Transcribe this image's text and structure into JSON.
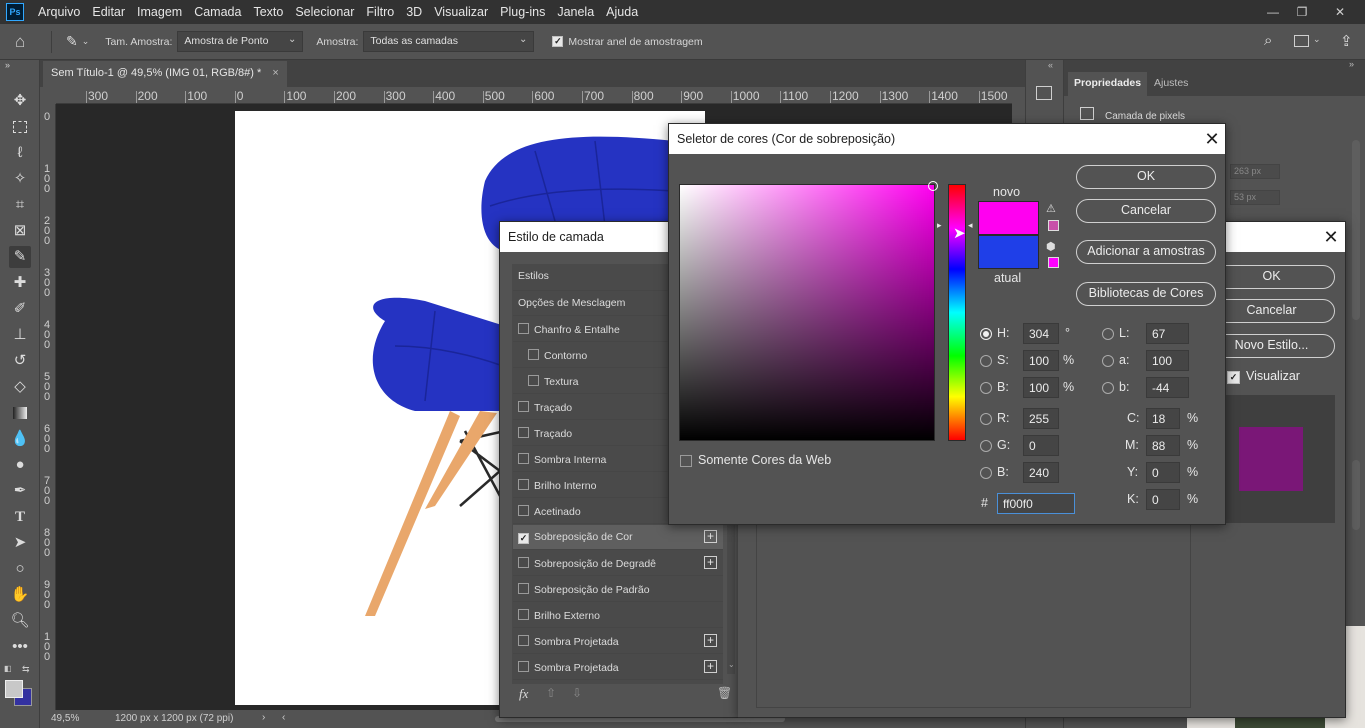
{
  "app": {
    "logo": "Ps"
  },
  "menu": [
    "Arquivo",
    "Editar",
    "Imagem",
    "Camada",
    "Texto",
    "Selecionar",
    "Filtro",
    "3D",
    "Visualizar",
    "Plug-ins",
    "Janela",
    "Ajuda"
  ],
  "window_controls": {
    "minimize": "—",
    "restore": "❐",
    "close": "✕"
  },
  "options_bar": {
    "sample_size_label": "Tam. Amostra:",
    "sample_size_value": "Amostra de Ponto",
    "sample_label": "Amostra:",
    "sample_value": "Todas as camadas",
    "show_ring_label": "Mostrar anel de amostragem",
    "show_ring_checked": true
  },
  "document": {
    "tab_title": "Sem Título-1 @ 49,5% (IMG 01, RGB/8#) *",
    "tab_close": "×",
    "ruler_h": [
      "300",
      "200",
      "100",
      "0",
      "100",
      "200",
      "300",
      "400",
      "500",
      "600",
      "700",
      "800",
      "900",
      "1000",
      "1100",
      "1200",
      "1300",
      "1400",
      "1500"
    ],
    "ruler_v": [
      "0",
      "1\n0\n0",
      "2\n0\n0",
      "3\n0\n0",
      "4\n0\n0",
      "5\n0\n0",
      "6\n0\n0",
      "7\n0\n0",
      "8\n0\n0",
      "9\n0\n0",
      "1\n0\n0"
    ],
    "zoom": "49,5%",
    "dimensions": "1200 px x 1200 px (72 ppi)"
  },
  "properties_panel": {
    "tab_properties": "Propriedades",
    "tab_adjustments": "Ajustes",
    "layer_type": "Camada de pixels",
    "w_value": "263 px",
    "h_value": "53 px"
  },
  "layer_style_dialog": {
    "title": "Estilo de camada",
    "header_styles": "Estilos",
    "header_blending": "Opções de Mesclagem",
    "items": [
      {
        "label": "Chanfro & Entalhe",
        "checked": false,
        "indent": false,
        "plus": false
      },
      {
        "label": "Contorno",
        "checked": false,
        "indent": true,
        "plus": false
      },
      {
        "label": "Textura",
        "checked": false,
        "indent": true,
        "plus": false
      },
      {
        "label": "Traçado",
        "checked": false,
        "indent": false,
        "plus": true
      },
      {
        "label": "Traçado",
        "checked": false,
        "indent": false,
        "plus": true
      },
      {
        "label": "Sombra Interna",
        "checked": false,
        "indent": false,
        "plus": true
      },
      {
        "label": "Brilho Interno",
        "checked": false,
        "indent": false,
        "plus": false
      },
      {
        "label": "Acetinado",
        "checked": false,
        "indent": false,
        "plus": false
      },
      {
        "label": "Sobreposição de Cor",
        "checked": true,
        "indent": false,
        "plus": true
      },
      {
        "label": "Sobreposição de Degradê",
        "checked": false,
        "indent": false,
        "plus": true
      },
      {
        "label": "Sobreposição de Padrão",
        "checked": false,
        "indent": false,
        "plus": false
      },
      {
        "label": "Brilho Externo",
        "checked": false,
        "indent": false,
        "plus": false
      },
      {
        "label": "Sombra Projetada",
        "checked": false,
        "indent": false,
        "plus": true
      },
      {
        "label": "Sombra Projetada",
        "checked": false,
        "indent": false,
        "plus": true
      }
    ],
    "fx_label": "fx",
    "ok": "OK",
    "cancel": "Cancelar",
    "new_style": "Novo Estilo...",
    "preview_label": "Visualizar",
    "preview_checked": true,
    "preview_color": "#7a1777"
  },
  "color_picker": {
    "title": "Seletor de cores (Cor de sobreposição)",
    "close": "✕",
    "new_label": "novo",
    "current_label": "atual",
    "new_color": "#ff00f0",
    "current_color": "#1f3fe8",
    "ok": "OK",
    "cancel": "Cancelar",
    "add_to_swatches": "Adicionar a amostras",
    "color_libraries": "Bibliotecas de Cores",
    "web_only_label": "Somente Cores da Web",
    "web_only_checked": false,
    "hsb": {
      "h": "304",
      "s": "100",
      "b": "100",
      "h_unit": "°",
      "s_unit": "%",
      "b_unit": "%"
    },
    "rgb": {
      "r": "255",
      "g": "0",
      "b": "240"
    },
    "lab": {
      "l": "67",
      "a": "100",
      "b": "-44"
    },
    "cmyk": {
      "c": "18",
      "m": "88",
      "y": "0",
      "k": "0",
      "unit": "%"
    },
    "hex_label": "#",
    "hex": "ff00f0",
    "labels": {
      "h": "H:",
      "s": "S:",
      "b": "B:",
      "r": "R:",
      "g": "G:",
      "bb": "B:",
      "l": "L:",
      "a": "a:",
      "lb": "b:",
      "c": "C:",
      "m": "M:",
      "y": "Y:",
      "k": "K:"
    },
    "selected_channel": "H"
  },
  "colors": {
    "chair_blue": "#2533c2",
    "chair_leg": "#e9a76b",
    "hue_marker": "#ff00f0"
  }
}
